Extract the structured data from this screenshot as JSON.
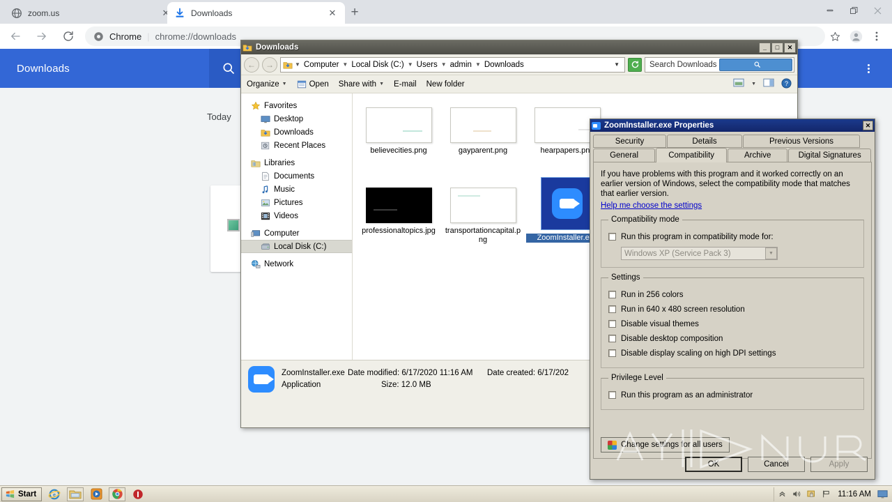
{
  "browser": {
    "tabs": [
      {
        "title": "zoom.us",
        "icon": "globe-icon",
        "active": false
      },
      {
        "title": "Downloads",
        "icon": "download-icon",
        "active": true
      }
    ],
    "new_tab_label": "+",
    "window_controls": [
      "minimize",
      "restore",
      "close"
    ],
    "toolbar": {
      "back": "←",
      "forward": "→",
      "reload": "⟳",
      "omnibox_chip": "Chrome",
      "omnibox_separator": "|",
      "omnibox_url": "chrome://downloads",
      "bookmark_icon": "star-icon",
      "profile_icon": "avatar-icon",
      "menu_icon": "kebab-menu-icon"
    }
  },
  "downloads_page": {
    "header_title": "Downloads",
    "search_icon": "search-icon",
    "menu_icon": "kebab-menu-icon",
    "section_label": "Today",
    "item_thumb": "image-thumbnail"
  },
  "explorer": {
    "title": "Downloads",
    "title_icon": "downloads-folder-icon",
    "window_buttons": {
      "minimize": "_",
      "maximize": "□",
      "close": "✕"
    },
    "nav_back": "←",
    "nav_forward": "→",
    "breadcrumbs": [
      "Computer",
      "Local Disk (C:)",
      "Users",
      "admin",
      "Downloads"
    ],
    "address_dropdown": "▼",
    "refresh_icon": "refresh-icon",
    "search_placeholder": "Search Downloads",
    "search_button_icon": "search-icon",
    "toolbar": [
      {
        "label": "Organize",
        "has_caret": true,
        "icon": null
      },
      {
        "label": "Open",
        "has_caret": false,
        "icon": "open-icon"
      },
      {
        "label": "Share with",
        "has_caret": true,
        "icon": null
      },
      {
        "label": "E-mail",
        "has_caret": false,
        "icon": null
      },
      {
        "label": "New folder",
        "has_caret": false,
        "icon": null
      }
    ],
    "toolbar_right": [
      {
        "icon": "view-layout-icon"
      },
      {
        "icon": "chevron-down-icon"
      },
      {
        "icon": "preview-pane-icon"
      },
      {
        "icon": "help-icon"
      }
    ],
    "nav_pane": [
      {
        "label": "Favorites",
        "icon": "star-icon",
        "level": 0,
        "selected": false
      },
      {
        "label": "Desktop",
        "icon": "desktop-icon",
        "level": 1,
        "selected": false
      },
      {
        "label": "Downloads",
        "icon": "downloads-folder-icon",
        "level": 1,
        "selected": false
      },
      {
        "label": "Recent Places",
        "icon": "recent-places-icon",
        "level": 1,
        "selected": false
      },
      {
        "label": "Libraries",
        "icon": "libraries-icon",
        "level": 0,
        "selected": false
      },
      {
        "label": "Documents",
        "icon": "documents-icon",
        "level": 1,
        "selected": false
      },
      {
        "label": "Music",
        "icon": "music-icon",
        "level": 1,
        "selected": false
      },
      {
        "label": "Pictures",
        "icon": "pictures-icon",
        "level": 1,
        "selected": false
      },
      {
        "label": "Videos",
        "icon": "videos-icon",
        "level": 1,
        "selected": false
      },
      {
        "label": "Computer",
        "icon": "computer-icon",
        "level": 0,
        "selected": false
      },
      {
        "label": "Local Disk (C:)",
        "icon": "hard-disk-icon",
        "level": 1,
        "selected": true
      },
      {
        "label": "Network",
        "icon": "network-icon",
        "level": 0,
        "selected": false
      }
    ],
    "files": [
      {
        "name": "believecities.png",
        "kind": "image-light",
        "selected": false
      },
      {
        "name": "gayparent.png",
        "kind": "image-light",
        "selected": false
      },
      {
        "name": "hearpapers.png",
        "kind": "image-light",
        "selected": false
      },
      {
        "name": "professionaltopics.jpg",
        "kind": "image-dark",
        "selected": false
      },
      {
        "name": "transportationcapital.png",
        "kind": "image-light",
        "selected": false
      },
      {
        "name": "ZoomInstaller.exe",
        "kind": "zoom-app",
        "selected": true
      }
    ],
    "details_pane": {
      "file_name": "ZoomInstaller.exe",
      "file_type": "Application",
      "date_modified_label": "Date modified:",
      "date_modified_value": "6/17/2020 11:16 AM",
      "size_label": "Size:",
      "size_value": "12.0 MB",
      "date_created_label": "Date created:",
      "date_created_value": "6/17/202",
      "icon": "zoom-app-icon"
    }
  },
  "properties_dialog": {
    "title": "ZoomInstaller.exe Properties",
    "title_icon": "zoom-app-icon",
    "close_label": "✕",
    "tabs_top": [
      "Security",
      "Details",
      "Previous Versions"
    ],
    "tabs_bottom": [
      "General",
      "Compatibility",
      "Archive",
      "Digital Signatures"
    ],
    "active_tab": "Compatibility",
    "intro_text": "If you have problems with this program and it worked correctly on an earlier version of Windows, select the compatibility mode that matches that earlier version.",
    "help_link": "Help me choose the settings",
    "compatibility_mode": {
      "legend": "Compatibility mode",
      "checkbox_label": "Run this program in compatibility mode for:",
      "checked": false,
      "combo_value": "Windows XP (Service Pack 3)",
      "combo_disabled": true,
      "combo_arrow": "▼"
    },
    "settings": {
      "legend": "Settings",
      "items": [
        {
          "label": "Run in 256 colors",
          "checked": false
        },
        {
          "label": "Run in 640 x 480 screen resolution",
          "checked": false
        },
        {
          "label": "Disable visual themes",
          "checked": false
        },
        {
          "label": "Disable desktop composition",
          "checked": false
        },
        {
          "label": "Disable display scaling on high DPI settings",
          "checked": false
        }
      ]
    },
    "privilege_level": {
      "legend": "Privilege Level",
      "items": [
        {
          "label": "Run this program as an administrator",
          "checked": false
        }
      ]
    },
    "change_settings_button": "Change settings for all users",
    "change_settings_icon": "uac-shield-icon",
    "buttons": [
      {
        "label": "OK",
        "state": "default"
      },
      {
        "label": "Cancel",
        "state": "normal"
      },
      {
        "label": "Apply",
        "state": "disabled"
      }
    ]
  },
  "watermark": {
    "text": "ANY RUN"
  },
  "taskbar": {
    "start_label": "Start",
    "start_icon": "windows-flag-icon",
    "quicklaunch": [
      {
        "icon": "internet-explorer-icon",
        "active": false
      },
      {
        "icon": "file-explorer-icon",
        "active": true
      },
      {
        "icon": "media-player-icon",
        "active": false
      },
      {
        "icon": "chrome-icon",
        "active": false
      },
      {
        "icon": "record-stop-icon",
        "active": false
      }
    ],
    "tray": [
      {
        "icon": "show-hidden-icons-icon"
      },
      {
        "icon": "volume-icon"
      },
      {
        "icon": "action-center-icon"
      },
      {
        "icon": "network-flag-icon"
      }
    ],
    "clock": "11:16 AM",
    "show-desktop": "show-desktop-icon"
  }
}
